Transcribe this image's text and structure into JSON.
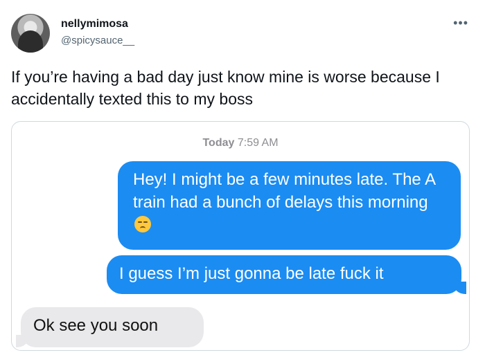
{
  "author": {
    "display_name": "nellymimosa",
    "handle": "@spicysauce__",
    "avatar_icon": "profile-photo"
  },
  "more_icon": "•••",
  "tweet": {
    "text": "If you’re having a bad day just know mine is worse because I accidentally texted this to my boss"
  },
  "conversation": {
    "day": "Today",
    "time": "7:59 AM",
    "messages": [
      {
        "from": "me",
        "text": "Hey! I might be a few minutes late. The A train had a bunch of delays this morning",
        "emoji": "pensive-face"
      },
      {
        "from": "me",
        "text": "I guess I’m just gonna be late fuck it"
      },
      {
        "from": "them",
        "text": "Ok see you soon"
      }
    ]
  },
  "colors": {
    "sent_bubble": "#1b8cf2",
    "received_bubble": "#e9e9eb",
    "border": "#cfd9de"
  }
}
